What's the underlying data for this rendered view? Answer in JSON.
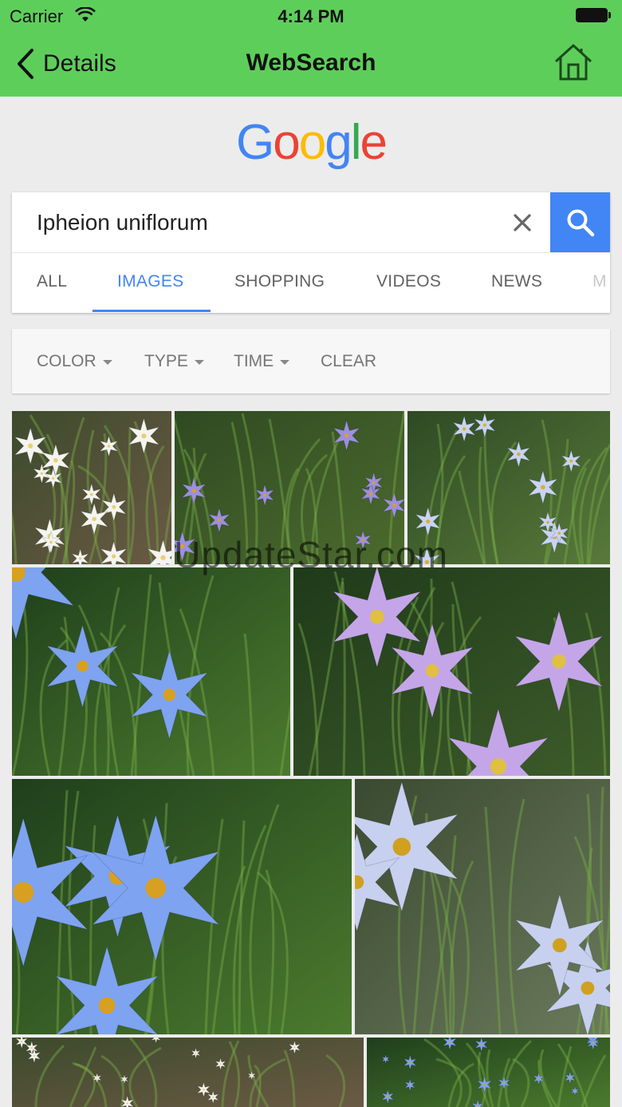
{
  "status_bar": {
    "carrier": "Carrier",
    "time": "4:14 PM"
  },
  "nav": {
    "back_label": "Details",
    "title": "WebSearch"
  },
  "google": {
    "logo_letters": [
      "G",
      "o",
      "o",
      "g",
      "l",
      "e"
    ],
    "logo_colors": [
      "#4285f4",
      "#ea4335",
      "#fbbc05",
      "#4285f4",
      "#34a853",
      "#ea4335"
    ]
  },
  "search": {
    "query": "Ipheion uniflorum"
  },
  "tabs": [
    {
      "label": "ALL",
      "active": false
    },
    {
      "label": "IMAGES",
      "active": true
    },
    {
      "label": "SHOPPING",
      "active": false
    },
    {
      "label": "VIDEOS",
      "active": false
    },
    {
      "label": "NEWS",
      "active": false
    },
    {
      "label": "M",
      "active": false
    }
  ],
  "filters": {
    "color": "COLOR",
    "type": "TYPE",
    "time": "TIME",
    "clear": "CLEAR"
  },
  "watermark": "UpdateStar.com",
  "colors": {
    "header": "#5ece5b",
    "accent": "#4285f4"
  },
  "images": [
    {
      "subject": "white star flowers clump",
      "scheme": "white"
    },
    {
      "subject": "purple star flowers close-up",
      "scheme": "purple"
    },
    {
      "subject": "blue-white star flowers field",
      "scheme": "bluewhite"
    },
    {
      "subject": "light blue flowers close-up",
      "scheme": "blue"
    },
    {
      "subject": "lilac flowers in garden bed",
      "scheme": "lilac"
    },
    {
      "subject": "single blue star flower on grass",
      "scheme": "blue"
    },
    {
      "subject": "pale blue flowers side view",
      "scheme": "pale"
    },
    {
      "subject": "white flower cluster",
      "scheme": "white"
    },
    {
      "subject": "blue flowers partial",
      "scheme": "blue"
    }
  ]
}
